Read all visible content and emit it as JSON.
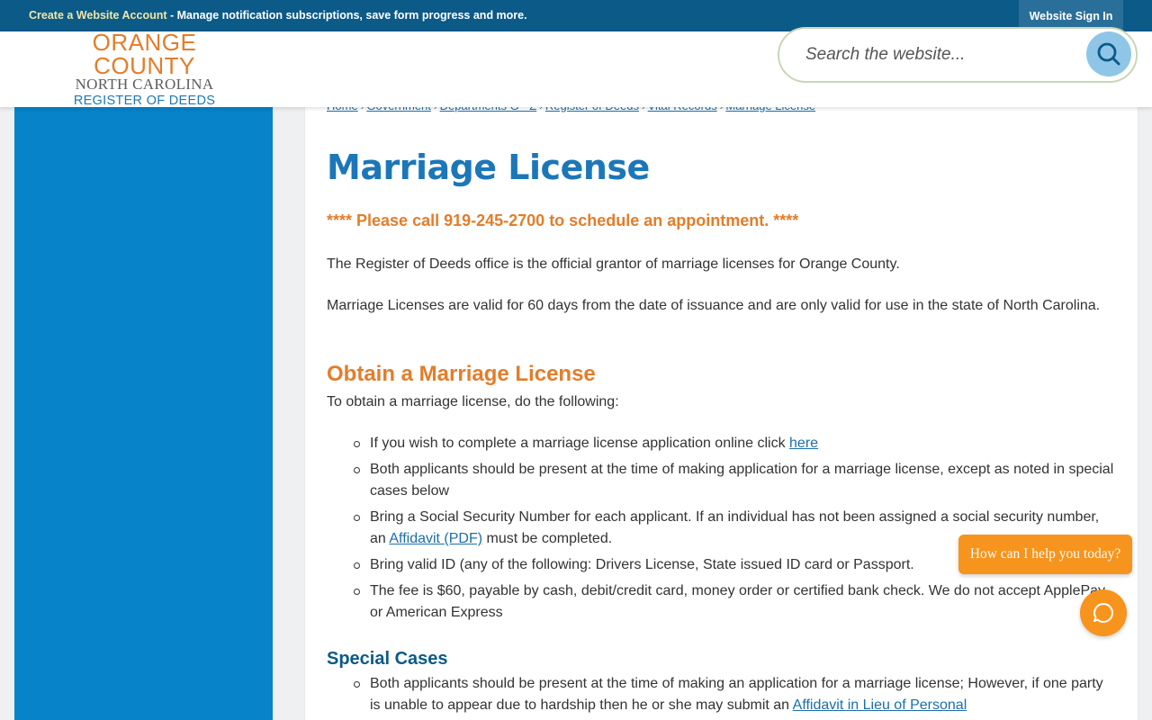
{
  "topbar": {
    "create_account": "Create a Website Account",
    "message": " - Manage notification subscriptions, save form progress and more.",
    "sign_in": "Website Sign In"
  },
  "logo": {
    "line1": "ORANGE COUNTY",
    "line2": "NORTH CAROLINA",
    "line3": "REGISTER OF DEEDS"
  },
  "search": {
    "placeholder": "Search the website..."
  },
  "breadcrumbs": [
    "Home",
    "Government",
    "Departments G - Z",
    "Register of Deeds",
    "Vital Records",
    "Marriage License"
  ],
  "page": {
    "title": "Marriage License",
    "alert": "**** Please call 919-245-2700 to schedule an appointment. ****",
    "intro1": "The Register of Deeds office is the official grantor of marriage licenses for Orange County.",
    "intro2": "Marriage Licenses are valid for 60 days from the date of issuance and are only valid for use in the state of North Carolina.",
    "obtain_heading": "Obtain a Marriage License",
    "obtain_intro": "To obtain a marriage license, do the following:",
    "items": {
      "i1_text": "If you wish to complete a marriage license application online click ",
      "i1_link": "here",
      "i2_text": "Both applicants should be present at the time of making application for a marriage license, except as noted in special cases below",
      "i3_text_a": "Bring a Social Security Number for each applicant. If an individual has not been assigned a social security number, an ",
      "i3_link": "Affidavit (PDF)",
      "i3_text_b": " must be completed.",
      "i4_text": "Bring valid ID (any of the following: Drivers License, State issued ID card or Passport.",
      "i5_text": "The fee is $60, payable by cash, debit/credit card, money order or certified bank check. We do not accept ApplePay or American Express"
    },
    "special_heading": "Special Cases",
    "special": {
      "s1_text": "Both applicants should be present at the time of making an application for a marriage license; However, if one party is unable to appear due to hardship then he or she may submit an ",
      "s1_link": "Affidavit in Lieu of Personal"
    }
  },
  "chat": {
    "prompt": "How can I help you today?"
  },
  "colors": {
    "brand_blue": "#0b5a88",
    "accent_orange": "#e37d2a",
    "sidebar_blue": "#0683c9",
    "link": "#1c6fa8"
  }
}
